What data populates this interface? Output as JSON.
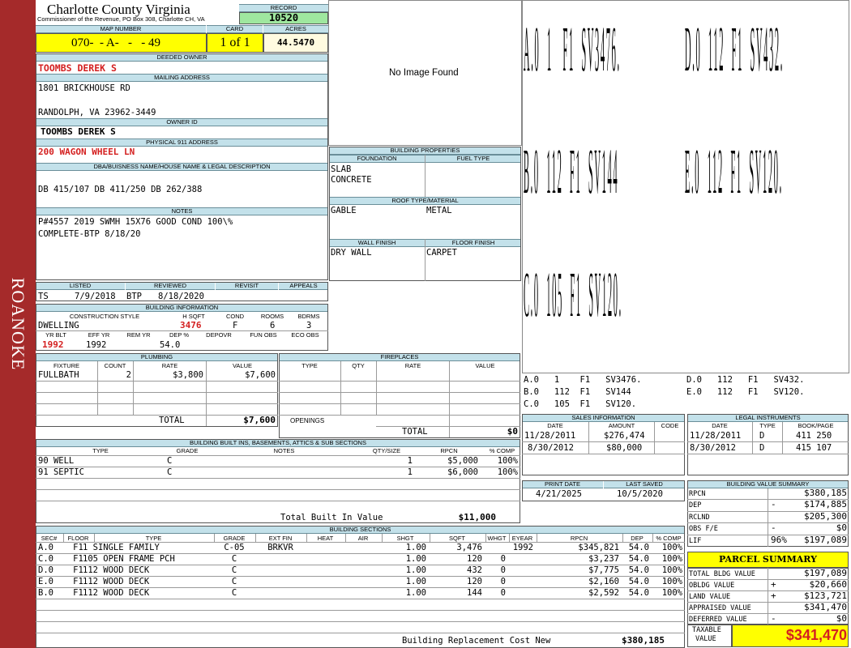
{
  "sidebar": {
    "label": "ROANOKE",
    "color": "#a52a2a"
  },
  "header": {
    "county": "Charlotte County Virginia",
    "commissioner": "Commissioner of the Revenue, PO Box 308, Charlotte CH, VA",
    "record_label": "RECORD",
    "record": "10520",
    "map_number_label": "MAP NUMBER",
    "map_number": "070-  - A-   -   - 49",
    "card_label": "CARD",
    "card": "1 of 1",
    "acres_label": "ACRES",
    "acres": "44.5470"
  },
  "owner": {
    "deeded_owner_label": "DEEDED OWNER",
    "deeded_owner": "TOOMBS DEREK S",
    "mailing_label": "MAILING ADDRESS",
    "mailing_line1": "1801 BRICKHOUSE RD",
    "mailing_line2": "RANDOLPH, VA 23962-3449",
    "owner_id_label": "OWNER ID",
    "owner_id": "TOOMBS DEREK S",
    "physical_label": "PHYSICAL 911 ADDRESS",
    "physical": "200 WAGON WHEEL LN",
    "dba_label": "DBA/BUISNESS NAME/HOUSE NAME & LEGAL DESCRIPTION",
    "legal": "DB 415/107 DB 411/250 DB 262/388",
    "notes_label": "NOTES",
    "notes_line1": "P#4557 2019 SWMH 15X76 GOOD COND 100\\%",
    "notes_line2": "COMPLETE-BTP 8/18/20"
  },
  "image": {
    "placeholder": "No Image Found"
  },
  "building_props": {
    "title": "BUILDING PROPERTIES",
    "foundation_label": "FOUNDATION",
    "fuel_label": "FUEL TYPE",
    "foundation1": "SLAB",
    "foundation2": "CONCRETE",
    "roof_label": "ROOF TYPE/MATERIAL",
    "roof_type": "GABLE",
    "roof_material": "METAL",
    "wall_label": "WALL FINISH",
    "floor_label": "FLOOR FINISH",
    "wall": "DRY WALL",
    "floor": "CARPET"
  },
  "listing": {
    "listed_label": "LISTED",
    "reviewed_label": "REVIEWED",
    "revisit_label": "REVISIT",
    "appeals_label": "APPEALS",
    "listed_by": "TS",
    "listed_date": "7/9/2018",
    "reviewed_by": "BTP",
    "reviewed_date": "8/18/2020"
  },
  "building_info": {
    "title": "BUILDING INFORMATION",
    "style_label": "CONSTRUCTION STYLE",
    "hsqft_label": "H SQFT",
    "cond_label": "COND",
    "rooms_label": "ROOMS",
    "bdrms_label": "BDRMS",
    "style": "DWELLING",
    "hsqft": "3476",
    "cond": "F",
    "rooms": "6",
    "bdrms": "3",
    "yrblt_label": "YR BLT",
    "effyr_label": "EFF YR",
    "remyr_label": "REM YR",
    "dep_label": "DEP %",
    "depovr_label": "DEPOVR",
    "funobs_label": "FUN OBS",
    "ecoobs_label": "ECO OBS",
    "yrblt": "1992",
    "effyr": "1992",
    "dep": "54.0"
  },
  "plumbing": {
    "title": "PLUMBING",
    "headers": [
      "FIXTURE",
      "COUNT",
      "RATE",
      "VALUE"
    ],
    "rows": [
      [
        "FULLBATH",
        "2",
        "$3,800",
        "$7,600"
      ]
    ],
    "total_label": "TOTAL",
    "total": "$7,600"
  },
  "fireplaces": {
    "title": "FIREPLACES",
    "headers": [
      "TYPE",
      "QTY",
      "RATE",
      "VALUE"
    ],
    "openings_label": "OPENINGS",
    "total_label": "TOTAL",
    "total": "$0"
  },
  "builtins": {
    "title": "BUILDING BUILT INS, BASEMENTS, ATTICS & SUB SECTIONS",
    "headers": [
      "TYPE",
      "GRADE",
      "NOTES",
      "QTY/SIZE",
      "RPCN",
      "% COMP"
    ],
    "rows": [
      [
        "90 WELL",
        "C",
        "",
        "1",
        "$5,000",
        "100%"
      ],
      [
        "91 SEPTIC",
        "C",
        "",
        "1",
        "$6,000",
        "100%"
      ]
    ],
    "total_label": "Total Built In Value",
    "total": "$11,000"
  },
  "sketch": {
    "big_labels": [
      [
        "A.0  1   F1  SV3476.",
        "D.0  112  F1  SV432."
      ],
      [
        "B.0  112  F1  SV144",
        "E.0  112  F1  SV120."
      ],
      [
        "C.0  105  F1  SV120.",
        ""
      ]
    ],
    "legend": [
      [
        "A.0   1    F1   SV3476.",
        "D.0   112   F1   SV432."
      ],
      [
        "B.0   112  F1   SV144",
        "E.0   112   F1   SV120."
      ],
      [
        "C.0   105  F1   SV120.",
        ""
      ]
    ]
  },
  "sales": {
    "title": "SALES INFORMATION",
    "headers": [
      "DATE",
      "AMOUNT",
      "CODE"
    ],
    "rows": [
      [
        "11/28/2011",
        "$276,474",
        ""
      ],
      [
        "8/30/2012",
        "$80,000",
        ""
      ]
    ]
  },
  "legal": {
    "title": "LEGAL INSTRUMENTS",
    "headers": [
      "DATE",
      "TYPE",
      "BOOK/PAGE"
    ],
    "rows": [
      [
        "11/28/2011",
        "D",
        "411 250"
      ],
      [
        "8/30/2012",
        "D",
        "415 107"
      ]
    ]
  },
  "print": {
    "print_label": "PRINT DATE",
    "saved_label": "LAST SAVED",
    "print_date": "4/21/2025",
    "last_saved": "10/5/2020"
  },
  "value_summary": {
    "title": "BUILDING VALUE SUMMARY",
    "rows": [
      [
        "RPCN",
        "",
        "$380,185"
      ],
      [
        "DEP",
        "-",
        "$174,885"
      ],
      [
        "RCLND",
        "",
        "$205,300"
      ],
      [
        "OBS F/E",
        "-",
        "$0"
      ],
      [
        "LIF",
        "96%",
        "$197,089"
      ]
    ]
  },
  "parcel": {
    "title": "PARCEL SUMMARY",
    "rows": [
      [
        "TOTAL BLDG VALUE",
        "",
        "$197,089"
      ],
      [
        "OBLDG VALUE",
        "+",
        "$20,660"
      ],
      [
        "LAND VALUE",
        "+",
        "$123,721"
      ],
      [
        "APPRAISED VALUE",
        "",
        "$341,470"
      ],
      [
        "DEFERRED VALUE",
        "-",
        "$0"
      ]
    ],
    "taxable_label1": "TAXABLE",
    "taxable_label2": "VALUE",
    "taxable": "$341,470"
  },
  "sections": {
    "title": "BUILDING SECTIONS",
    "headers": [
      "SEC#",
      "FLOOR",
      "TYPE",
      "GRADE",
      "EXT FIN",
      "HEAT",
      "AIR",
      "SHGT",
      "SQFT",
      "WHGT",
      "EYEAR",
      "RPCN",
      "DEP",
      "% COMP"
    ],
    "rows": [
      [
        "A.0",
        "F1",
        "1 SINGLE FAMILY",
        "C-05",
        "BRKVR",
        "",
        "",
        "1.00",
        "3,476",
        "",
        "1992",
        "$345,821",
        "54.0",
        "100%"
      ],
      [
        "C.0",
        "F1",
        "105 OPEN FRAME PCH",
        "C",
        "",
        "",
        "",
        "1.00",
        "120",
        "0",
        "",
        "$3,237",
        "54.0",
        "100%"
      ],
      [
        "D.0",
        "F1",
        "112 WOOD DECK",
        "C",
        "",
        "",
        "",
        "1.00",
        "432",
        "0",
        "",
        "$7,775",
        "54.0",
        "100%"
      ],
      [
        "E.0",
        "F1",
        "112 WOOD DECK",
        "C",
        "",
        "",
        "",
        "1.00",
        "120",
        "0",
        "",
        "$2,160",
        "54.0",
        "100%"
      ],
      [
        "B.0",
        "F1",
        "112 WOOD DECK",
        "C",
        "",
        "",
        "",
        "1.00",
        "144",
        "0",
        "",
        "$2,592",
        "54.0",
        "100%"
      ]
    ],
    "rcn_label": "Building Replacement Cost New",
    "rcn": "$380,185"
  }
}
